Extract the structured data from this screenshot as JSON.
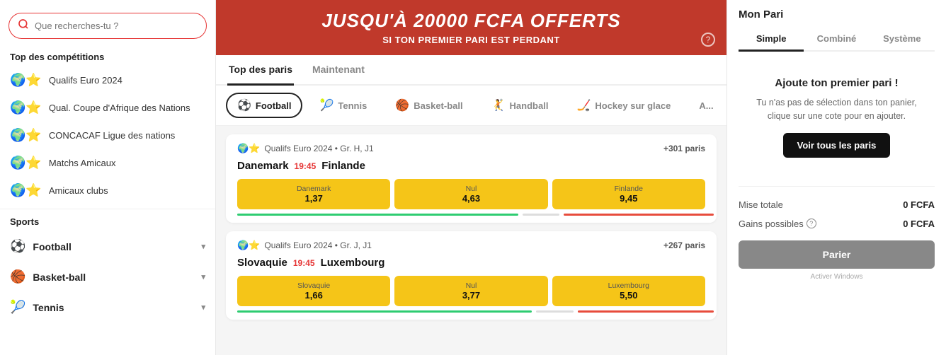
{
  "sidebar": {
    "search_placeholder": "Que recherches-tu ?",
    "top_competitions_title": "Top des compétitions",
    "competitions": [
      {
        "id": "qualifs-euro",
        "label": "Qualifs Euro 2024"
      },
      {
        "id": "qual-coupe-afrique",
        "label": "Qual. Coupe d'Afrique des Nations"
      },
      {
        "id": "concacaf",
        "label": "CONCACAF Ligue des nations"
      },
      {
        "id": "matchs-amicaux",
        "label": "Matchs Amicaux"
      },
      {
        "id": "amicaux-clubs",
        "label": "Amicaux clubs"
      }
    ],
    "sports_title": "Sports",
    "sports": [
      {
        "id": "football",
        "label": "Football",
        "icon": "⚽"
      },
      {
        "id": "basket-ball",
        "label": "Basket-ball",
        "icon": "🏀"
      },
      {
        "id": "tennis",
        "label": "Tennis",
        "icon": "🎾"
      }
    ]
  },
  "banner": {
    "title": "JUSQU'À 20000 FCFA OFFERTS",
    "subtitle": "SI TON PREMIER PARI EST PERDANT"
  },
  "tabs": [
    {
      "id": "top-paris",
      "label": "Top des paris",
      "active": true
    },
    {
      "id": "maintenant",
      "label": "Maintenant",
      "active": false
    }
  ],
  "sport_pills": [
    {
      "id": "football",
      "label": "Football",
      "icon": "⚽",
      "active": true
    },
    {
      "id": "tennis",
      "label": "Tennis",
      "icon": "🎾",
      "active": false
    },
    {
      "id": "basket-ball",
      "label": "Basket-ball",
      "icon": "🏀",
      "active": false
    },
    {
      "id": "handball",
      "label": "Handball",
      "icon": "🤾",
      "active": false
    },
    {
      "id": "hockey",
      "label": "Hockey sur glace",
      "icon": "🏒",
      "active": false
    },
    {
      "id": "autres",
      "label": "A...",
      "icon": "",
      "active": false
    }
  ],
  "matches": [
    {
      "id": "match-1",
      "league": "Qualifs Euro 2024 • Gr. H, J1",
      "plus_count": "+301 paris",
      "team1": "Danemark",
      "time": "19:45",
      "team2": "Finlande",
      "odds": [
        {
          "label": "Danemark",
          "value": "1,37"
        },
        {
          "label": "Nul",
          "value": "4,63"
        },
        {
          "label": "Finlande",
          "value": "9,45"
        }
      ],
      "progress": [
        60,
        5,
        35
      ]
    },
    {
      "id": "match-2",
      "league": "Qualifs Euro 2024 • Gr. J, J1",
      "plus_count": "+267 paris",
      "team1": "Slovaquie",
      "time": "19:45",
      "team2": "Luxembourg",
      "odds": [
        {
          "label": "Slovaquie",
          "value": "1,66"
        },
        {
          "label": "Nul",
          "value": "3,77"
        },
        {
          "label": "Luxembourg",
          "value": "5,50"
        }
      ],
      "progress": [
        65,
        5,
        30
      ]
    }
  ],
  "right_panel": {
    "title": "Mon Pari",
    "bet_tabs": [
      {
        "id": "simple",
        "label": "Simple",
        "active": true
      },
      {
        "id": "combine",
        "label": "Combiné",
        "active": false
      },
      {
        "id": "systeme",
        "label": "Système",
        "active": false
      }
    ],
    "empty_title": "Ajoute ton premier pari !",
    "empty_desc": "Tu n'as pas de sélection dans ton panier, clique sur une cote pour en ajouter.",
    "voir_btn_label": "Voir tous les paris",
    "mise_label": "Mise totale",
    "gains_label": "Gains possibles",
    "mise_value": "0 FCFA",
    "gains_value": "0 FCFA",
    "parier_label": "Parier",
    "windows_text": "Activer Windows"
  }
}
